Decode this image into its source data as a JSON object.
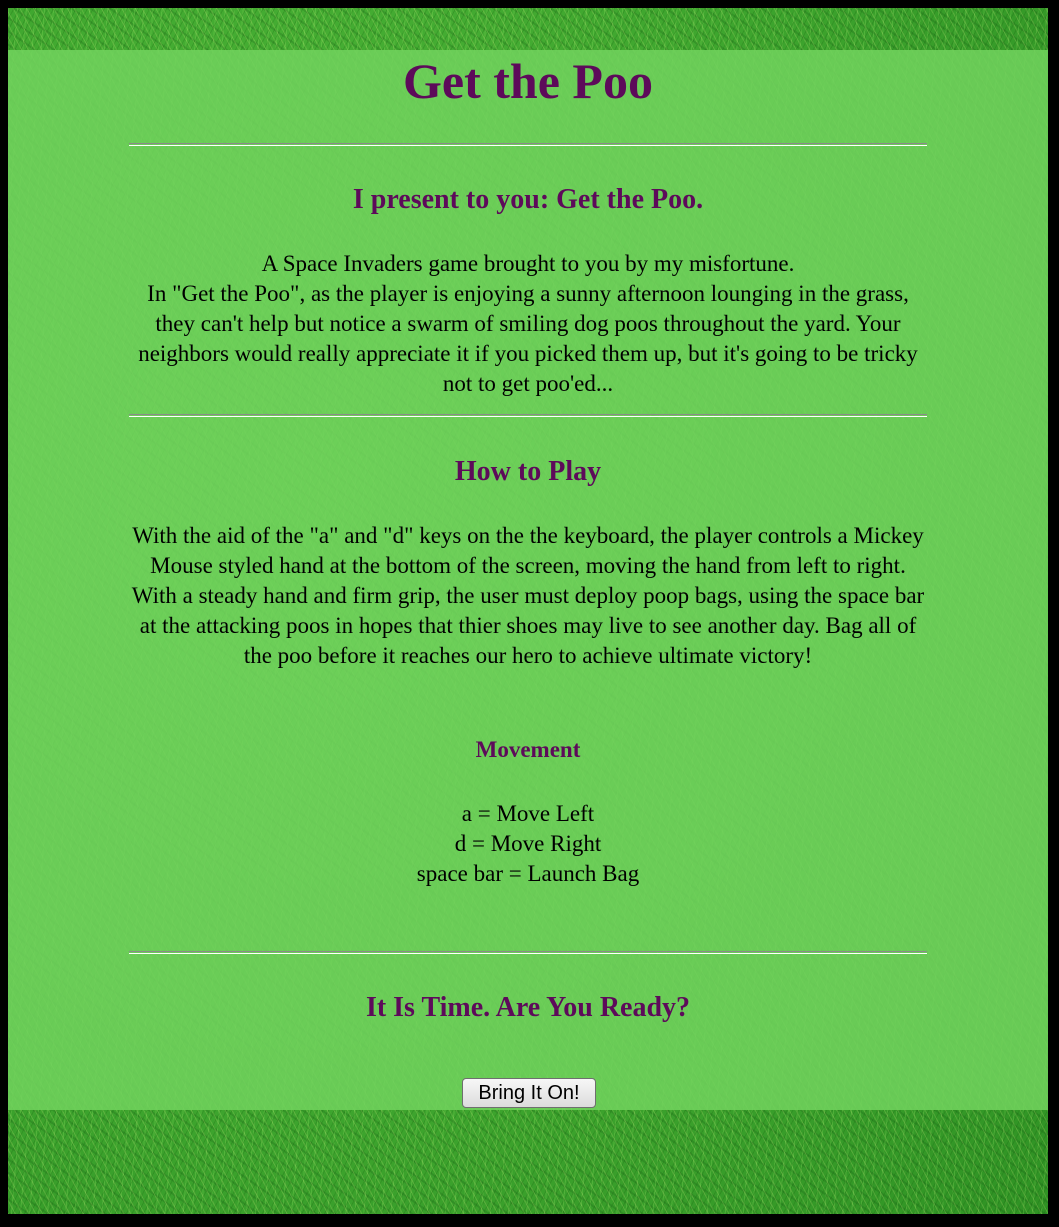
{
  "page": {
    "title": "Get the Poo"
  },
  "intro": {
    "heading": "I present to you: Get the Poo.",
    "line1": "A Space Invaders game brought to you by my misfortune.",
    "line2": "In \"Get the Poo\", as the player is enjoying a sunny afternoon lounging in the grass, they can't help but notice a swarm of smiling dog poos throughout the yard. Your neighbors would really appreciate it if you picked them up, but it's going to be tricky not to get poo'ed..."
  },
  "how_to_play": {
    "heading": "How to Play",
    "text": "With the aid of the \"a\" and \"d\" keys on the the keyboard, the player controls a Mickey Mouse styled hand at the bottom of the screen, moving the hand from left to right. With a steady hand and firm grip, the user must deploy poop bags, using the space bar at the attacking poos in hopes that thier shoes may live to see another day. Bag all of the poo before it reaches our hero to achieve ultimate victory!"
  },
  "movement": {
    "heading": "Movement",
    "controls": [
      "a = Move Left",
      "d = Move Right",
      "space bar = Launch Bag"
    ]
  },
  "ready": {
    "heading": "It Is Time. Are You Ready?",
    "button_label": "Bring It On!"
  },
  "colors": {
    "heading": "#5d0a5a",
    "panel": "#70d25c",
    "frame": "#000000"
  }
}
